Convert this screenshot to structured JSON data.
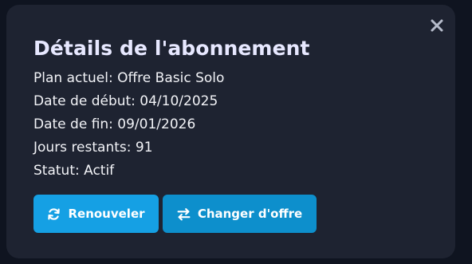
{
  "modal": {
    "title": "Détails de l'abonnement",
    "close_icon": "close-icon",
    "details": [
      {
        "label": "Plan actuel",
        "value": "Offre Basic Solo",
        "text": "Plan actuel: Offre Basic Solo"
      },
      {
        "label": "Date de début",
        "value": "04/10/2025",
        "text": "Date de début: 04/10/2025"
      },
      {
        "label": "Date de fin",
        "value": "09/01/2026",
        "text": "Date de fin: 09/01/2026"
      },
      {
        "label": "Jours restants",
        "value": "91",
        "text": "Jours restants: 91"
      },
      {
        "label": "Statut",
        "value": "Actif",
        "text": "Statut: Actif"
      }
    ],
    "actions": {
      "renew": {
        "label": "Renouveler",
        "icon": "refresh-icon",
        "color": "#15a0e4"
      },
      "change": {
        "label": "Changer d'offre",
        "icon": "swap-arrows-icon",
        "color": "#0d8fcc"
      }
    }
  },
  "colors": {
    "background": "#0f1420",
    "card": "#1e2331",
    "title": "#e7e8ff",
    "text": "#f2f3f7",
    "close_icon": "#b6bccb"
  }
}
